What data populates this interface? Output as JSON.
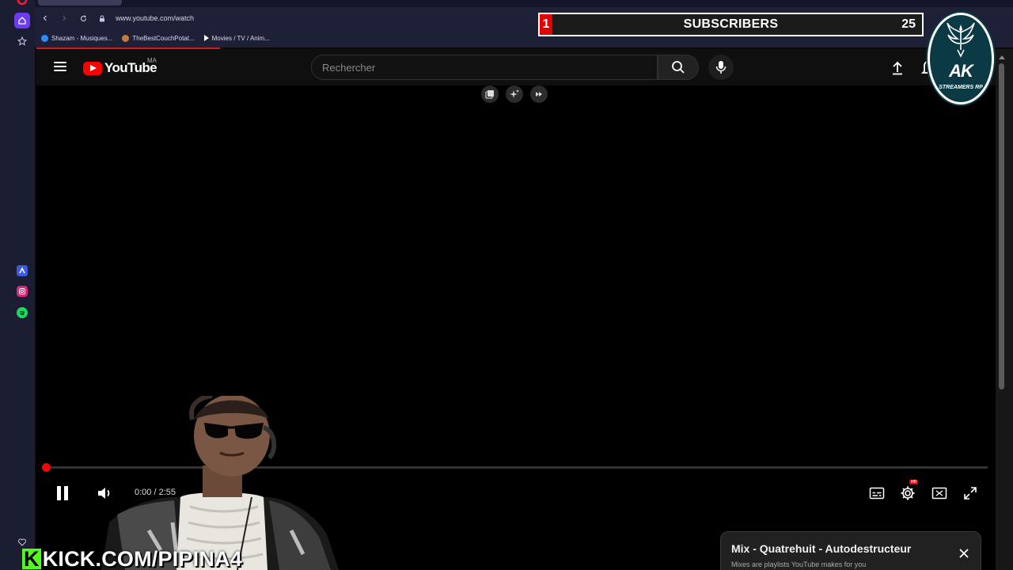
{
  "browser": {
    "url": "www.youtube.com/watch",
    "bookmarks": [
      {
        "label": "Shazam - Musiques...",
        "color": "#2f8cff"
      },
      {
        "label": "TheBestCouchPotat...",
        "color": "#c77a3a"
      },
      {
        "label": "Movies / TV / Anim...",
        "color": "#ffffff"
      }
    ],
    "sidebar_icons": [
      "home-icon",
      "star-icon",
      "aria-icon",
      "instagram-icon",
      "spotify-icon",
      "heart-icon"
    ]
  },
  "youtube": {
    "logo_text": "YouTube",
    "country_code": "MA",
    "search_placeholder": "Rechercher",
    "player": {
      "time": "0:00 / 2:55",
      "progress": 0.002,
      "hd_badge": "HD",
      "tool_icons": [
        "miniplayer-icon",
        "sparkle-icon",
        "skip-icon"
      ]
    },
    "mix_card": {
      "title": "Mix - Quatrehuit - Autodestructeur",
      "subtitle": "Mixes are playlists YouTube makes for you"
    }
  },
  "overlay": {
    "subscriber_count": "1",
    "subscriber_label": "SUBSCRIBERS",
    "subscriber_goal": "25",
    "logo_title": "AK",
    "logo_subtitle": "STREAMERS RP",
    "kick_k": "K",
    "kick_url": "KICK.COM/PIPINA4"
  },
  "colors": {
    "youtube_red": "#ff0000",
    "browser_chrome": "#1e2038",
    "kick_green": "#53fc18"
  }
}
